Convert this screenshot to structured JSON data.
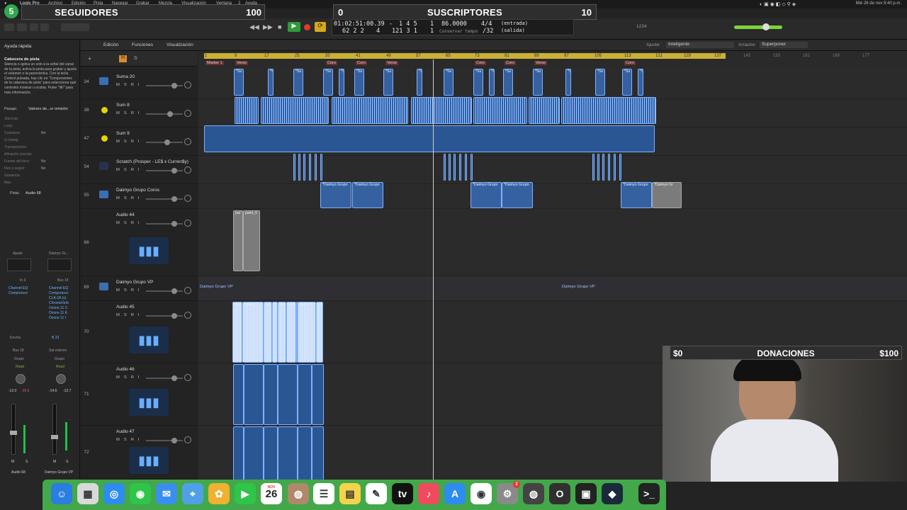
{
  "menubar": {
    "app": "Logic Pro",
    "menus": [
      "Archivo",
      "Edición",
      "Pista",
      "Navegar",
      "Grabar",
      "Mezcla",
      "Visualización",
      "Ventana",
      "2",
      "Ayuda"
    ],
    "clock": "Mié 26 de nov  9:40 p.m."
  },
  "overlay": {
    "streak": "5",
    "followers_label": "SEGUIDORES",
    "followers_goal": "100",
    "subs_count": "0",
    "subs_label": "SUSCRIPTORES",
    "subs_goal": "10",
    "donations_current": "$0",
    "donations_label": "DONACIONES",
    "donations_goal": "$100"
  },
  "lcd": {
    "time": "01:02:51:00.39",
    "dash": "-",
    "bars": "1  4  5",
    "beat_div": "1",
    "tempo": "86.0000",
    "signature": "4/4",
    "in": "(entrada)",
    "position": "62  2  2",
    "ticks": "4",
    "bars2": "121  3  1",
    "div2": "1",
    "tempo_mode": "Conservar tempo",
    "division": "/32",
    "out": "(salida)",
    "cpu": "1234"
  },
  "toolbar": {
    "edit": "Edición",
    "functions": "Funciones",
    "view": "Visualización",
    "snap_label": "Ajuste:",
    "snap_value": "Inteligente",
    "drag_label": "Arrastre:",
    "drag_value": "Superponer"
  },
  "inspector": {
    "quick_help": "Ayuda rápida",
    "help_title": "Cabecera de pista",
    "help_body": "Silencia o aplica un solo a la señal del canal de la pista, activa la pista para grabar y ajusta el volumen o la panorámica. Con la tecla Control pulsada, haz clic en \"Componentes de la cabecera de pista\" para seleccionar qué controles mostrar u ocultar. Pulse \"⌘/\" para más información.",
    "region_label": "Pasaje:",
    "region_value": "Valores de...or omisión",
    "props": [
      {
        "k": "Silenciar:",
        "v": ""
      },
      {
        "k": "Loop:",
        "v": ""
      },
      {
        "k": "Cuantizar:",
        "v": "No"
      },
      {
        "k": "Q-Swing:",
        "v": ""
      },
      {
        "k": "Transposición:",
        "v": ""
      },
      {
        "k": "Afinación precisa:",
        "v": ""
      },
      {
        "k": "Fuente del tono:",
        "v": "No"
      },
      {
        "k": "Flex y seguir:",
        "v": "No"
      },
      {
        "k": "Ganancia:",
        "v": ""
      },
      {
        "k": "Más",
        "v": ""
      }
    ],
    "track_label": "Pista:",
    "track_value": "Audio 68",
    "strip1": {
      "setting": "Ajuste",
      "input": "In 3",
      "plugins": [
        "Channel EQ",
        "Compressor"
      ],
      "sends": "Envíos",
      "output": "Bus 18",
      "group": "Grupo",
      "mode": "Read",
      "vol": "-12.0",
      "peak": "-16.9",
      "name": "Audio 68",
      "m": "M",
      "s": "S"
    },
    "strip2": {
      "setting": "Daimyo Gr...",
      "input": "Bus 18",
      "plugins": [
        "Channel EQ",
        "Compressor",
        "CLA-2A (s)",
        "ChromaVerb",
        "Ozone 11 C",
        "Ozone 11 E",
        "Ozone 11 I"
      ],
      "sends": "B 23",
      "output": "Sal estéreo",
      "group": "Grupo",
      "mode": "Read",
      "vol": "-14.6",
      "peak": "-12.7",
      "name": "Daimyo Grupo VP",
      "m": "M",
      "s": "S"
    }
  },
  "ruler": {
    "bars": [
      "1",
      "9",
      "17",
      "25",
      "33",
      "41",
      "49",
      "57",
      "65",
      "73",
      "81",
      "89",
      "97",
      "105",
      "113",
      "121",
      "129",
      "137",
      "145",
      "153",
      "161",
      "169",
      "177"
    ],
    "markers": [
      "Marker 1",
      "Verso",
      "Coro",
      "Coro",
      "Verso",
      "Coro",
      "Coro",
      "Verso",
      "Coro"
    ]
  },
  "tracks": [
    {
      "num": "34",
      "name": "Suma 20"
    },
    {
      "num": "38",
      "name": "Sum 8"
    },
    {
      "num": "47",
      "name": "Sum 9"
    },
    {
      "num": "54",
      "name": "Scratch (Prosper - LE$ x Curren$y)"
    },
    {
      "num": "55",
      "name": "Daimyo Grupo Coros"
    },
    {
      "num": "68",
      "name": "Audio 44"
    },
    {
      "num": "69",
      "name": "Daimyo Grupo VP"
    },
    {
      "num": "70",
      "name": "Audio 45"
    },
    {
      "num": "71",
      "name": "Audio 46"
    },
    {
      "num": "72",
      "name": "Audio 47"
    }
  ],
  "track_controls": {
    "m": "M",
    "s": "S",
    "r": "R",
    "i": "I"
  },
  "regions": {
    "su": "*Su",
    "s": "*S",
    "coros": "*Daimyo Grupo",
    "coros_last": "*Daimyo Gr",
    "pai": "pai",
    "paint": "paint_6",
    "vp_label": "Daimyo Grupo VP",
    "vp_label2": "Daimyo Grupo VP",
    "a45": [
      "pai",
      "paint_",
      "pai",
      "p",
      "pai",
      "pain",
      "pai",
      "paint_4",
      "pai"
    ]
  },
  "dock": {
    "apps": [
      "finder-icon",
      "launchpad-icon",
      "safari-icon",
      "messages-icon",
      "mail-icon",
      "maps-icon",
      "photos-icon",
      "facetime-icon",
      "calendar-icon",
      "contacts-icon",
      "reminders-icon",
      "notes-icon",
      "freeform-icon",
      "appletv-icon",
      "music-icon",
      "appstore-icon",
      "chrome-icon",
      "settings-icon",
      "logic-icon",
      "obs-icon",
      "finalcut-icon",
      "resolve-icon",
      "terminal-icon"
    ],
    "calendar_month": "NOV",
    "calendar_day": "26",
    "settings_badge": "2"
  }
}
